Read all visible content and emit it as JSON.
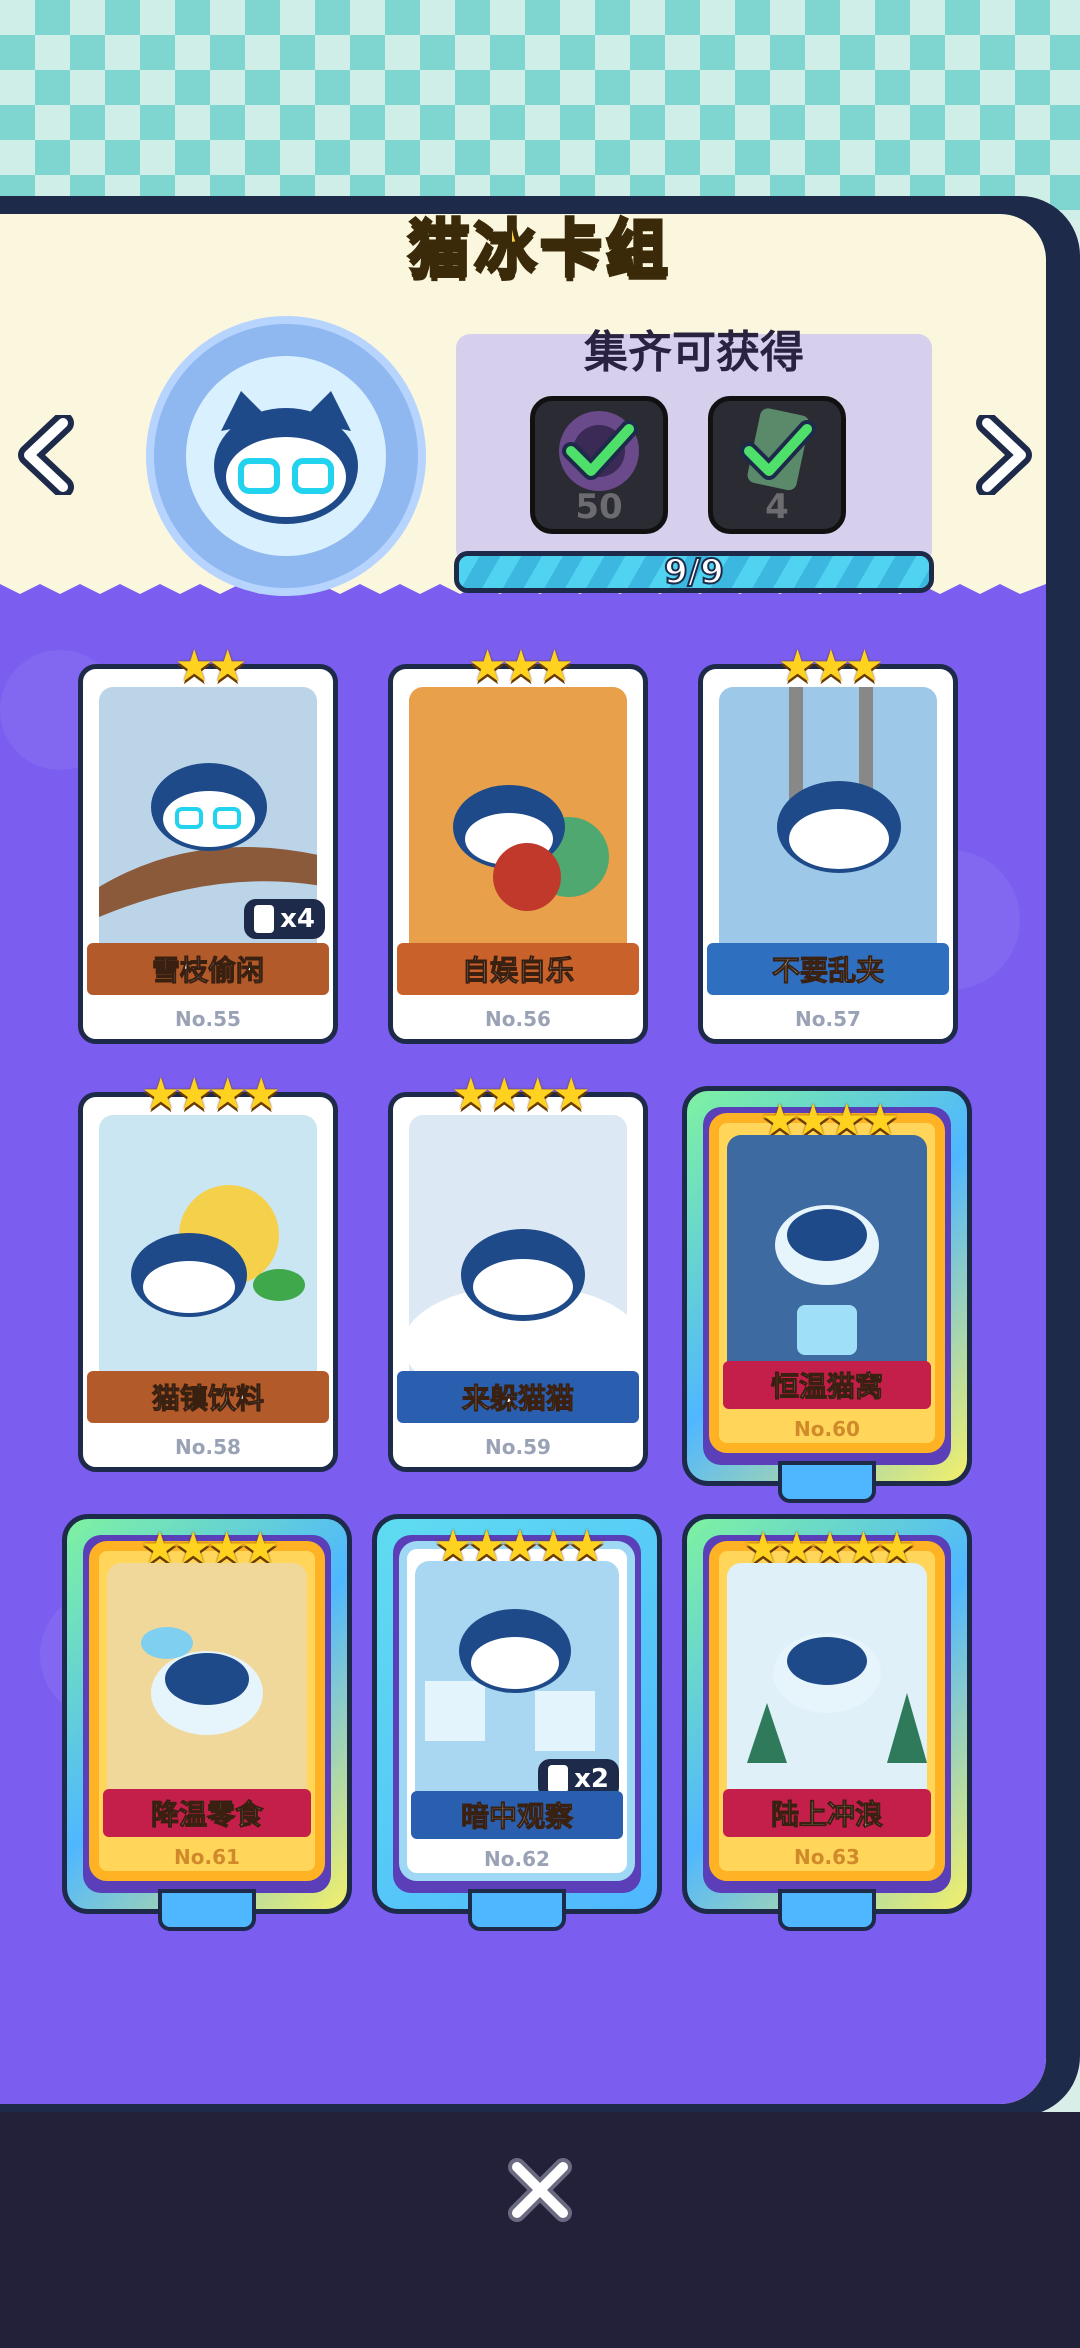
{
  "title": "猫冰卡组",
  "reward": {
    "heading": "集齐可获得",
    "items": [
      {
        "count": "50",
        "icon": "avatar-frame-icon",
        "claimed": true
      },
      {
        "count": "4",
        "icon": "card-pack-icon",
        "claimed": true
      }
    ],
    "progress_text": "9/9",
    "progress_value": 1.0
  },
  "nav": {
    "prev": "chevron-left-icon",
    "next": "chevron-right-icon"
  },
  "cards": [
    {
      "name": "雪枝偷闲",
      "no": "No.55",
      "stars": "★★",
      "dup": "x4",
      "banner_color": "#b35a2a",
      "art_color": "#bcd4e8",
      "gold": false
    },
    {
      "name": "自娱自乐",
      "no": "No.56",
      "stars": "★★★",
      "dup": "",
      "banner_color": "#c8612a",
      "art_color": "#e8a04a",
      "gold": false
    },
    {
      "name": "不要乱夹",
      "no": "No.57",
      "stars": "★★★",
      "dup": "",
      "banner_color": "#2f6fc0",
      "art_color": "#9ec8e8",
      "gold": false
    },
    {
      "name": "猫镇饮料",
      "no": "No.58",
      "stars": "★★★★",
      "dup": "",
      "banner_color": "#b35a2a",
      "art_color": "#c9e6f2",
      "gold": false
    },
    {
      "name": "来躲猫猫",
      "no": "No.59",
      "stars": "★★★★",
      "dup": "",
      "banner_color": "#2a5fb0",
      "art_color": "#dce8f4",
      "gold": false
    },
    {
      "name": "恒温猫窝",
      "no": "No.60",
      "stars": "★★★★",
      "dup": "",
      "banner_color": "#c41e4a",
      "art_color": "#3d6aa0",
      "gold": true
    },
    {
      "name": "降温零食",
      "no": "No.61",
      "stars": "★★★★",
      "dup": "",
      "banner_color": "#c41e4a",
      "art_color": "#f0d89a",
      "gold": true
    },
    {
      "name": "暗中观察",
      "no": "No.62",
      "stars": "★★★★★",
      "dup": "x2",
      "banner_color": "#2a5fb0",
      "art_color": "#a9d7f2",
      "gold": false
    },
    {
      "name": "陆上冲浪",
      "no": "No.63",
      "stars": "★★★★★",
      "dup": "",
      "banner_color": "#c41e4a",
      "art_color": "#dff0f8",
      "gold": true
    }
  ],
  "close": "close-icon"
}
